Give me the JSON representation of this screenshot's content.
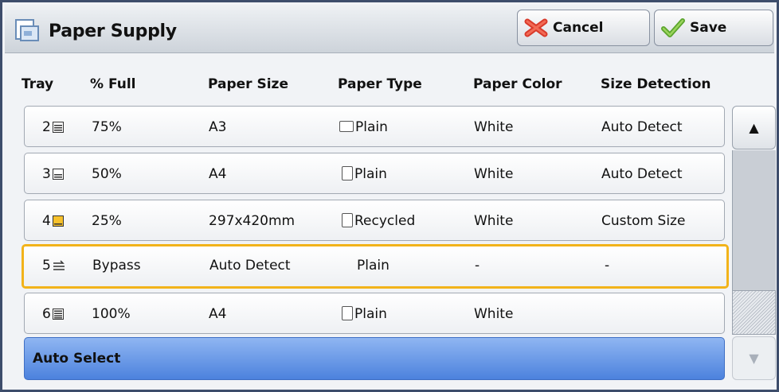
{
  "header": {
    "title": "Paper Supply",
    "cancel_label": "Cancel",
    "save_label": "Save"
  },
  "columns": [
    "Tray",
    "% Full",
    "Paper Size",
    "Paper Type",
    "Paper Color",
    "Size Detection"
  ],
  "rows": [
    {
      "tray": "2",
      "full": "75%",
      "size": "A3",
      "type": "Plain",
      "color": "White",
      "detection": "Auto Detect"
    },
    {
      "tray": "3",
      "full": "50%",
      "size": "A4",
      "type": "Plain",
      "color": "White",
      "detection": "Auto Detect"
    },
    {
      "tray": "4",
      "full": "25%",
      "size": "297x420mm",
      "type": "Recycled",
      "color": "White",
      "detection": "Custom Size"
    },
    {
      "tray": "5",
      "full": "Bypass",
      "size": "Auto Detect",
      "type": "Plain",
      "color": "-",
      "detection": "-"
    },
    {
      "tray": "6",
      "full": "100%",
      "size": "A4",
      "type": "Plain",
      "color": "White",
      "detection": ""
    }
  ],
  "auto_select_label": "Auto Select",
  "scroll": {
    "up_glyph": "▲",
    "down_glyph": "▼"
  },
  "colors": {
    "selected_border": "#f2b31a",
    "auto_select": "#5b8fe3"
  }
}
